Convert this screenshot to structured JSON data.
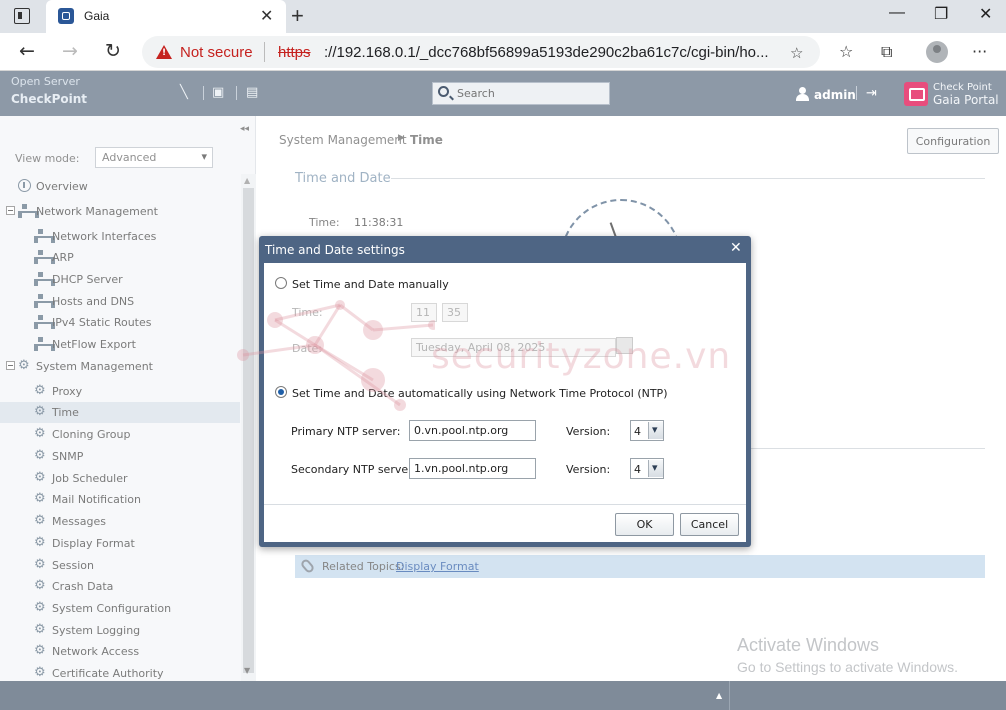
{
  "browser": {
    "tab_title": "Gaia",
    "tab_close": "✕",
    "new_tab": "+",
    "security_label": "Not secure",
    "url_scheme": "https",
    "url_rest": "://192.168.0.1/_dcc768bf56899a5193de290c2ba61c7c/cgi-bin/ho...",
    "window_controls": [
      "—",
      "❐",
      "✕"
    ]
  },
  "header": {
    "open_server": "Open Server",
    "product": "CheckPoint",
    "search_placeholder": "Search",
    "user": "admin",
    "brand_line1": "Check Point",
    "brand_line2": "Gaia Portal"
  },
  "sidebar": {
    "view_mode_label": "View mode:",
    "view_mode_value": "Advanced",
    "items": [
      {
        "label": "Overview"
      },
      {
        "label": "Network Management"
      },
      {
        "label": "Network Interfaces"
      },
      {
        "label": "ARP"
      },
      {
        "label": "DHCP Server"
      },
      {
        "label": "Hosts and DNS"
      },
      {
        "label": "IPv4 Static Routes"
      },
      {
        "label": "NetFlow Export"
      },
      {
        "label": "System Management"
      },
      {
        "label": "Proxy"
      },
      {
        "label": "Time"
      },
      {
        "label": "Cloning Group"
      },
      {
        "label": "SNMP"
      },
      {
        "label": "Job Scheduler"
      },
      {
        "label": "Mail Notification"
      },
      {
        "label": "Messages"
      },
      {
        "label": "Display Format"
      },
      {
        "label": "Session"
      },
      {
        "label": "Crash Data"
      },
      {
        "label": "System Configuration"
      },
      {
        "label": "System Logging"
      },
      {
        "label": "Network Access"
      },
      {
        "label": "Certificate Authority"
      }
    ]
  },
  "main": {
    "breadcrumb_parent": "System Management",
    "breadcrumb_current": "Time",
    "config_button": "Configuration",
    "section_title": "Time and Date",
    "time_label": "Time:",
    "time_value": "11:38:31",
    "related_label": "Related Topics:",
    "related_link": "Display Format",
    "activate_line1": "Activate Windows",
    "activate_line2": "Go to Settings to activate Windows."
  },
  "dialog": {
    "title": "Time and Date settings",
    "close": "✕",
    "manual_label": "Set Time and Date manually",
    "time_label": "Time:",
    "hour": "11",
    "minute": "35",
    "date_label": "Date:",
    "date_value": "Tuesday, April 08, 2025",
    "ntp_label": "Set Time and Date automatically using Network Time Protocol (NTP)",
    "primary_label": "Primary NTP server:",
    "primary_value": "0.vn.pool.ntp.org",
    "secondary_label": "Secondary NTP server:",
    "secondary_value": "1.vn.pool.ntp.org",
    "version_label": "Version:",
    "primary_version": "4",
    "secondary_version": "4",
    "ok": "OK",
    "cancel": "Cancel"
  },
  "watermark": {
    "text": "securityzone.vn"
  }
}
